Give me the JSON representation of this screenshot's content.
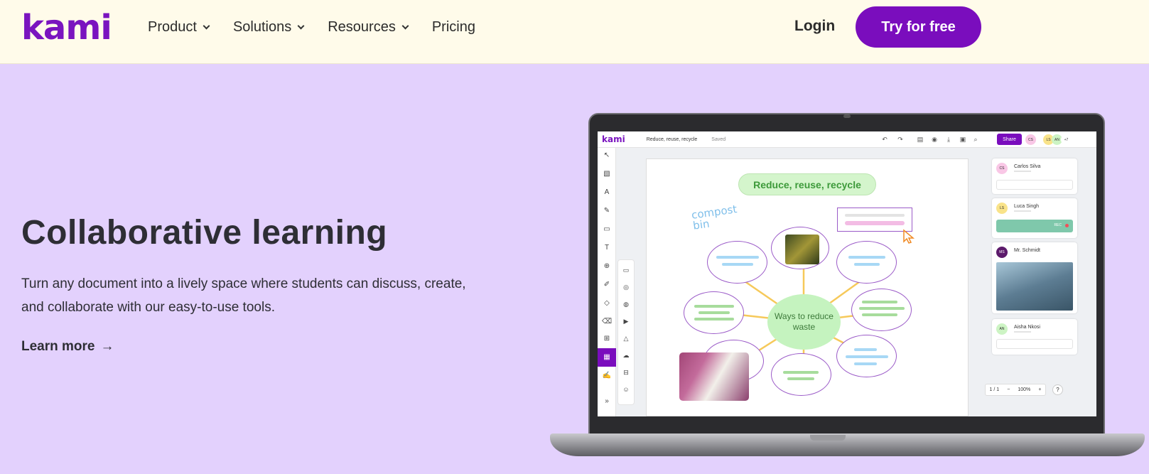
{
  "header": {
    "logo": "kami",
    "nav": [
      {
        "label": "Product",
        "has_dropdown": true
      },
      {
        "label": "Solutions",
        "has_dropdown": true
      },
      {
        "label": "Resources",
        "has_dropdown": true
      },
      {
        "label": "Pricing",
        "has_dropdown": false
      }
    ],
    "login": "Login",
    "cta": "Try for free"
  },
  "hero": {
    "title": "Collaborative learning",
    "description": "Turn any document into a lively space where students can discuss, create, and collaborate with our easy-to-use tools.",
    "learn_more": "Learn more",
    "learn_more_arrow": "→"
  },
  "app": {
    "logo": "kami",
    "doc_title": "Reduce, reuse, recycle",
    "saved": "Saved",
    "share": "Share",
    "top_avatars": [
      "CS",
      "LS",
      "AN"
    ],
    "more_count": "+7",
    "canvas": {
      "pill": "Reduce, reuse, recycle",
      "handwriting": "compost bin",
      "center": "Ways to reduce waste"
    },
    "comments": [
      {
        "initials": "CS",
        "name": "Carlos Silva"
      },
      {
        "initials": "LS",
        "name": "Luca Singh",
        "rec_label": "REC"
      },
      {
        "initials": "MS",
        "name": "Mr. Schmidt"
      },
      {
        "initials": "AN",
        "name": "Aisha Nkosi"
      }
    ],
    "page_indicator": "1 / 1",
    "zoom": "100%",
    "zoom_minus": "−",
    "zoom_plus": "+",
    "help": "?"
  },
  "colors": {
    "brand": "#7a0dbd",
    "hero_bg": "#e3d1fd",
    "header_bg": "#fffbea"
  }
}
